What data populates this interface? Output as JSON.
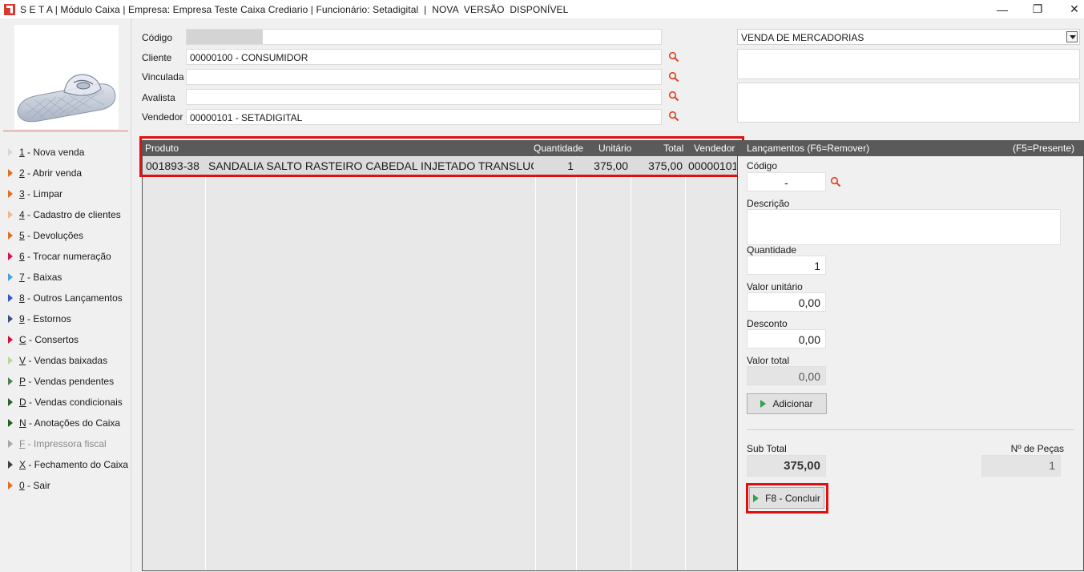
{
  "window": {
    "title": "S E T A | Módulo Caixa | Empresa: Empresa Teste Caixa Crediario | Funcionário: Setadigital  |  NOVA  VERSÃO  DISPONÍVEL",
    "minimize": "—",
    "maximize": "❐",
    "close": "✕"
  },
  "colors": {
    "accent_red": "#e01010",
    "header_gray": "#5a5a5a",
    "play_green": "#2da44e"
  },
  "sidebar": {
    "items": [
      {
        "key": "1",
        "label": " - Nova venda",
        "arrow_color": "#d8d8d8"
      },
      {
        "key": "2",
        "label": " - Abrir venda",
        "arrow_color": "#e07020"
      },
      {
        "key": "3",
        "label": " - Limpar",
        "arrow_color": "#e07020"
      },
      {
        "key": "4",
        "label": " - Cadastro de clientes",
        "arrow_color": "#f0b890"
      },
      {
        "key": "5",
        "label": " - Devoluções",
        "arrow_color": "#e07020"
      },
      {
        "key": "6",
        "label": " - Trocar numeração",
        "arrow_color": "#e01050"
      },
      {
        "key": "7",
        "label": " - Baixas",
        "arrow_color": "#4aa0e0"
      },
      {
        "key": "8",
        "label": " - Outros Lançamentos",
        "arrow_color": "#3858c8"
      },
      {
        "key": "9",
        "label": " - Estornos",
        "arrow_color": "#3a5080"
      },
      {
        "key": "C",
        "label": " - Consertos",
        "arrow_color": "#d01040"
      },
      {
        "key": "V",
        "label": " - Vendas baixadas",
        "arrow_color": "#b8d898"
      },
      {
        "key": "P",
        "label": " - Vendas pendentes",
        "arrow_color": "#508050"
      },
      {
        "key": "D",
        "label": " - Vendas condicionais",
        "arrow_color": "#306030"
      },
      {
        "key": "N",
        "label": " - Anotações do Caixa",
        "arrow_color": "#206020"
      },
      {
        "key": "F",
        "label": " - Impressora fiscal",
        "arrow_color": "#a8a8a8",
        "disabled": true
      },
      {
        "key": "X",
        "label": " - Fechamento do Caixa",
        "arrow_color": "#404040"
      },
      {
        "key": "0",
        "label": " - Sair",
        "arrow_color": "#e07020"
      }
    ]
  },
  "form": {
    "codigo_label": "Código",
    "codigo_value": "",
    "cliente_label": "Cliente",
    "cliente_value": "00000100 - CONSUMIDOR",
    "vinculada_label": "Vinculada",
    "vinculada_value": "",
    "avalista_label": "Avalista",
    "avalista_value": "",
    "vendedor_label": "Vendedor",
    "vendedor_value": "00000101 - SETADIGITAL",
    "tipo_venda": "VENDA DE MERCADORIAS"
  },
  "grid": {
    "columns": [
      "Produto",
      "Quantidade",
      "Unitário",
      "Total",
      "Vendedor"
    ],
    "rows": [
      {
        "codigo": "001893-38",
        "descricao": "SANDALIA SALTO RASTEIRO CABEDAL INJETADO TRANSLUCIDO",
        "quantidade": "1",
        "unitario": "375,00",
        "total": "375,00",
        "vendedor": "00000101"
      }
    ]
  },
  "lancamentos": {
    "header_left": "Lançamentos (F6=Remover)",
    "header_right": "(F5=Presente)",
    "codigo_label": "Código",
    "codigo_value": "-",
    "descricao_label": "Descrição",
    "descricao_value": "",
    "quantidade_label": "Quantidade",
    "quantidade_value": "1",
    "valor_unitario_label": "Valor unitário",
    "valor_unitario_value": "0,00",
    "desconto_label": "Desconto",
    "desconto_value": "0,00",
    "valor_total_label": "Valor total",
    "valor_total_value": "0,00",
    "adicionar_label": "Adicionar",
    "subtotal_label": "Sub Total",
    "subtotal_value": "375,00",
    "pecas_label": "Nº de Peças",
    "pecas_value": "1",
    "concluir_label": "F8 - Concluir"
  }
}
